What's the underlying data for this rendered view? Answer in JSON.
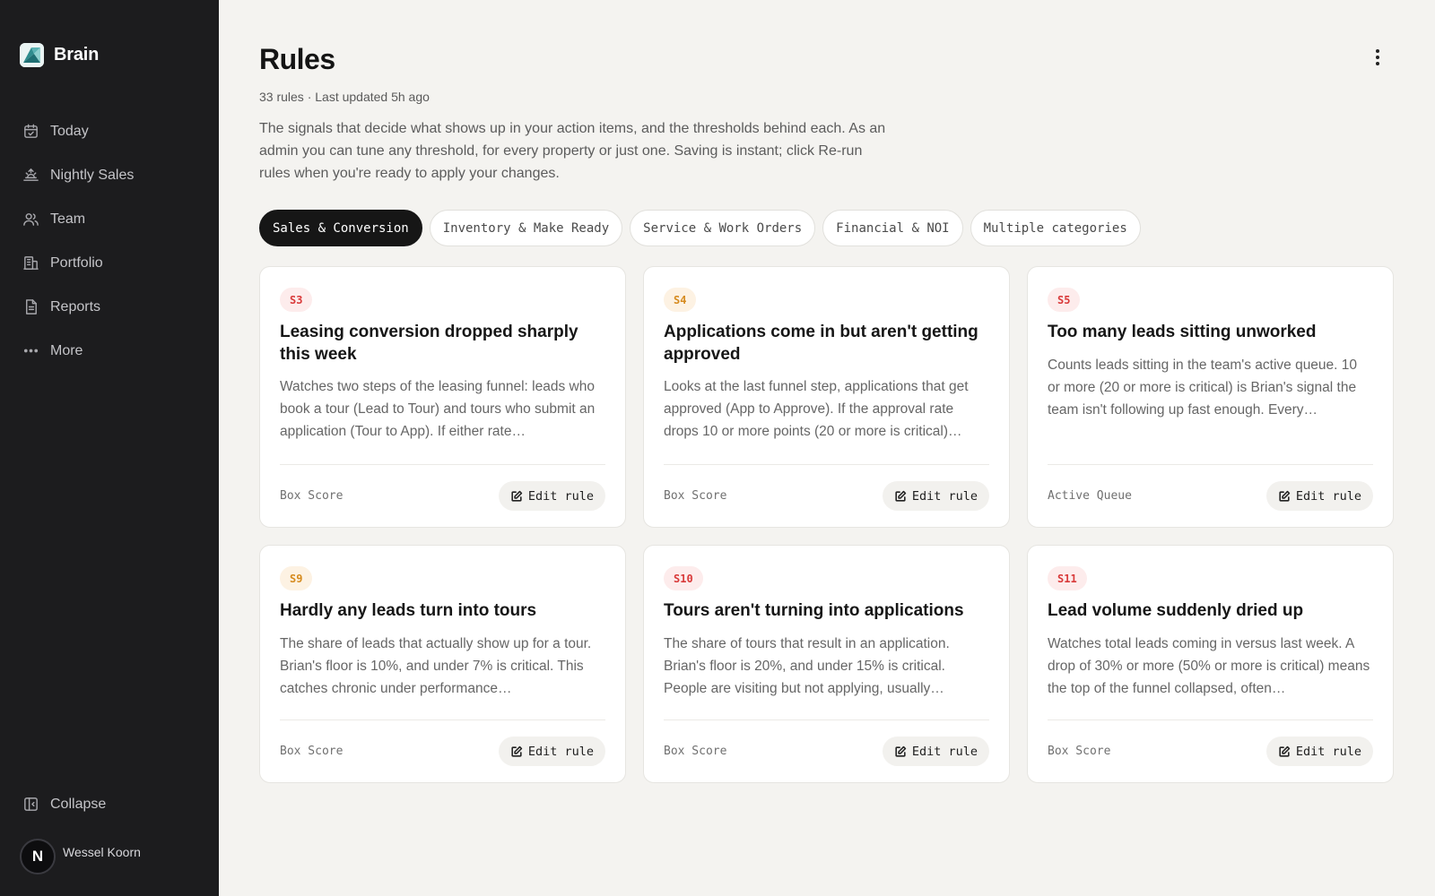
{
  "brand": {
    "name": "Brain"
  },
  "sidebar": {
    "items": [
      {
        "label": "Today",
        "icon": "calendar-icon"
      },
      {
        "label": "Nightly Sales",
        "icon": "sunset-icon"
      },
      {
        "label": "Team",
        "icon": "users-icon"
      },
      {
        "label": "Portfolio",
        "icon": "building-icon"
      },
      {
        "label": "Reports",
        "icon": "document-icon"
      },
      {
        "label": "More",
        "icon": "more-dots-icon"
      }
    ],
    "collapse_label": "Collapse",
    "user": {
      "initial": "N",
      "name": "Wessel Koorn"
    }
  },
  "header": {
    "title": "Rules",
    "meta": "33 rules · Last updated 5h ago",
    "description": "The signals that decide what shows up in your action items, and the thresholds behind each. As an admin you can tune any threshold, for every property or just one. Saving is instant; click Re-run rules when you're ready to apply your changes."
  },
  "tabs": [
    {
      "label": "Sales & Conversion",
      "active": true
    },
    {
      "label": "Inventory & Make Ready",
      "active": false
    },
    {
      "label": "Service & Work Orders",
      "active": false
    },
    {
      "label": "Financial & NOI",
      "active": false
    },
    {
      "label": "Multiple categories",
      "active": false
    }
  ],
  "cards": [
    {
      "code": "S3",
      "severity": "red",
      "title": "Leasing conversion dropped sharply this week",
      "description": "Watches two steps of the leasing funnel: leads who book a tour (Lead to Tour) and tours who submit an application (Tour to App). If either rate…",
      "source": "Box Score",
      "action": "Edit rule"
    },
    {
      "code": "S4",
      "severity": "orange",
      "title": "Applications come in but aren't getting approved",
      "description": "Looks at the last funnel step, applications that get approved (App to Approve). If the approval rate drops 10 or more points (20 or more is critical)…",
      "source": "Box Score",
      "action": "Edit rule"
    },
    {
      "code": "S5",
      "severity": "red",
      "title": "Too many leads sitting unworked",
      "description": "Counts leads sitting in the team's active queue. 10 or more (20 or more is critical) is Brian's signal the team isn't following up fast enough. Every…",
      "source": "Active Queue",
      "action": "Edit rule"
    },
    {
      "code": "S9",
      "severity": "orange",
      "title": "Hardly any leads turn into tours",
      "description": "The share of leads that actually show up for a tour. Brian's floor is 10%, and under 7% is critical. This catches chronic under performance…",
      "source": "Box Score",
      "action": "Edit rule"
    },
    {
      "code": "S10",
      "severity": "red",
      "title": "Tours aren't turning into applications",
      "description": "The share of tours that result in an application. Brian's floor is 20%, and under 15% is critical. People are visiting but not applying, usually…",
      "source": "Box Score",
      "action": "Edit rule"
    },
    {
      "code": "S11",
      "severity": "red",
      "title": "Lead volume suddenly dried up",
      "description": "Watches total leads coming in versus last week. A drop of 30% or more (50% or more is critical) means the top of the funnel collapsed, often…",
      "source": "Box Score",
      "action": "Edit rule"
    }
  ]
}
